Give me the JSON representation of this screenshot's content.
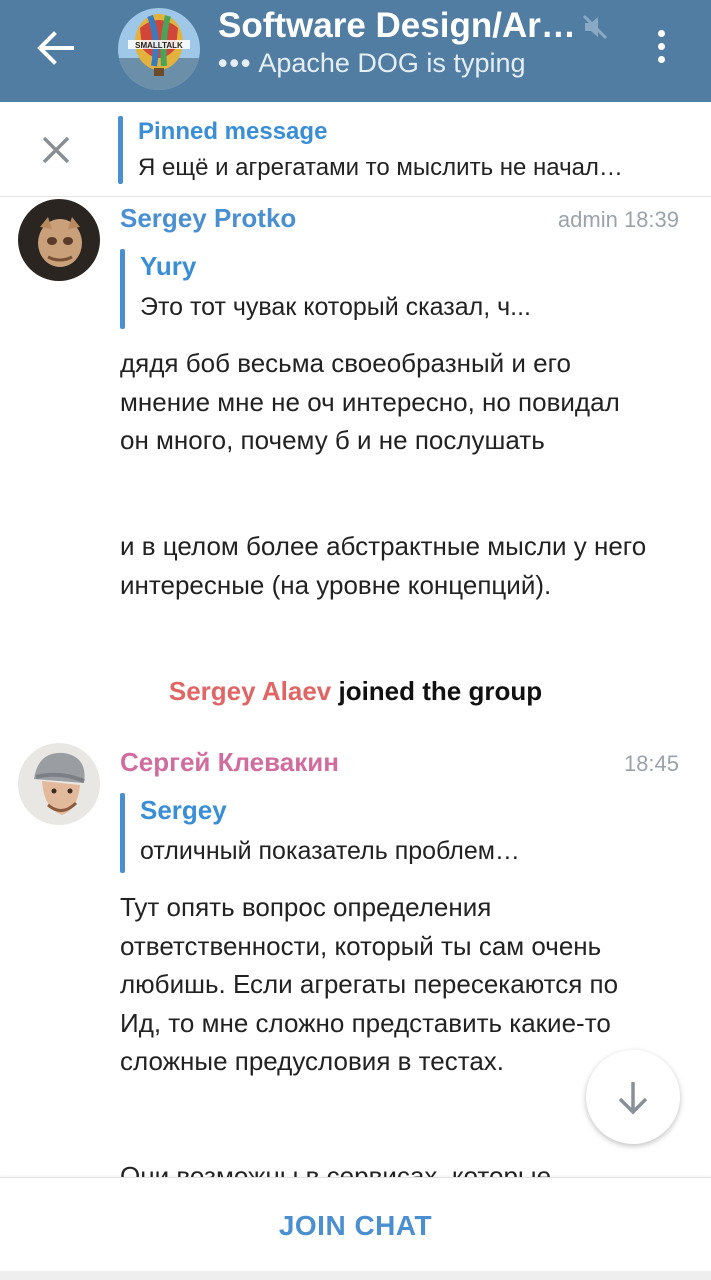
{
  "header": {
    "title": "Software Design/Arc…",
    "typing_dots": "•••",
    "subtitle": "Apache DOG is typing",
    "avatar_text": "SMALLTALK",
    "bg_color": "#517da2"
  },
  "pinned": {
    "title": "Pinned message",
    "text": "Я ещё и агрегатами то мыслить не начал…"
  },
  "messages": [
    {
      "sender": "Sergey Protko",
      "sender_color": "#4a90d0",
      "meta": "admin 18:39",
      "reply": {
        "name": "Yury",
        "text": "Это тот чувак который сказал, ч..."
      },
      "paragraphs": [
        "дядя боб весьма своеобразный и его мнение мне не оч интересно, но повидал он много, почему б и не послушать",
        "и в целом более абстрактные мысли у него интересные (на уровне концепций)."
      ]
    },
    {
      "sender": "Сергей Клевакин",
      "sender_color": "#d16d9e",
      "meta": "18:45",
      "reply": {
        "name": "Sergey",
        "text": "отличный показатель проблем…"
      },
      "paragraphs": [
        "Тут опять вопрос определения ответственности, который ты сам очень любишь. Если агрегаты пересекаются по Ид, то мне сложно представить какие-то сложные предусловия в тестах.",
        "Они возможны в сервисах, которые"
      ]
    }
  ],
  "service": {
    "who": "Sergey Alaev",
    "action": " joined the group"
  },
  "bottom": {
    "join_label": "JOIN CHAT"
  }
}
